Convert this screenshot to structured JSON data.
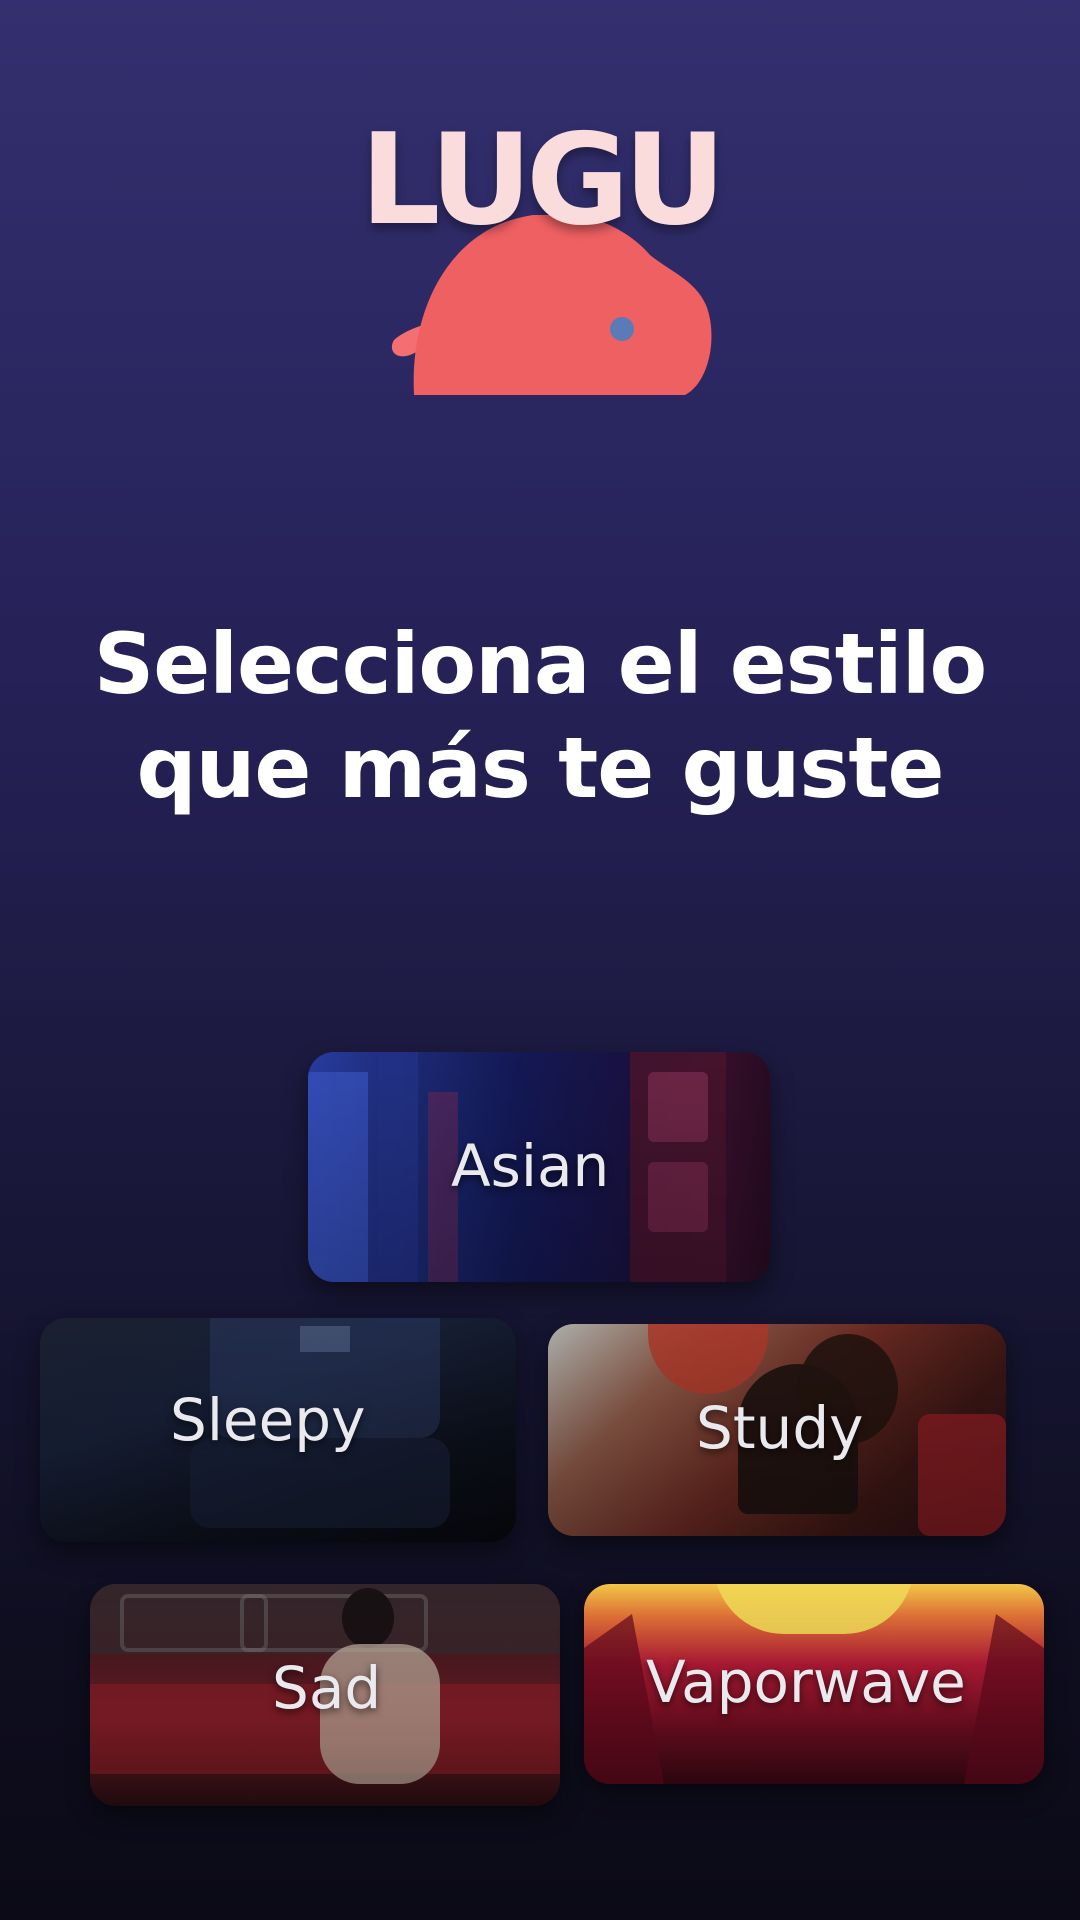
{
  "app": {
    "logo_text": "LUGU"
  },
  "headline": {
    "line1": "Selecciona el estilo",
    "line2": "que más te guste"
  },
  "styles": [
    {
      "label": "Asian"
    },
    {
      "label": "Sleepy"
    },
    {
      "label": "Study"
    },
    {
      "label": "Sad"
    },
    {
      "label": "Vaporwave"
    }
  ],
  "colors": {
    "background_top": "#34306f",
    "background_bottom": "#0b0a16",
    "logo_text": "#fbdcdc",
    "logo_creature": "#ef6062",
    "logo_eye": "#5a7bb8"
  }
}
